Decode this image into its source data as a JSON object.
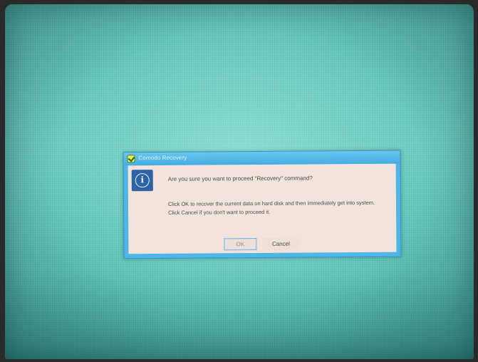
{
  "dialog": {
    "title": "Comodo Recovery",
    "icon": "info-icon",
    "message_primary": "Are you sure you want to proceed \"Recovery\" command?",
    "message_line1": "Click OK to recover the current data on hard disk and then immediately get into system.",
    "message_line2": "Click Cancel if you don't want to proceed it.",
    "buttons": {
      "ok_label": "OK",
      "cancel_label": "Cancel"
    }
  },
  "colors": {
    "desktop": "#5ec2b7",
    "dialog_frame": "#4fb6e6",
    "dialog_body": "#f3e4db",
    "info_icon_bg": "#2e63a6"
  }
}
